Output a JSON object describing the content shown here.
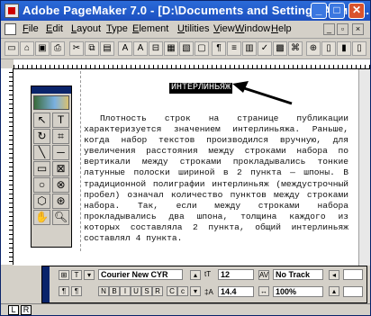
{
  "window": {
    "title": "Adobe PageMaker 7.0 - [D:\\Documents and Settings\\Админ..."
  },
  "menu": [
    "File",
    "Edit",
    "Layout",
    "Type",
    "Element",
    "Utilities",
    "View",
    "Window",
    "Help"
  ],
  "page": {
    "heading": "ИНТЕРЛИНЬЯЖ",
    "paragraph": "Плотность строк на странице публикации характеризуется значением интерлиньяжа. Раньше, когда набор текстов производился вручную, для увеличения расстояния между строками набора по вертикали между строками прокладывались тонкие латунные полоски шириной в 2 пункта — шпоны. В традиционной полиграфии интерлиньяж (междустрочный пробел) означал количество пунктов между строками набора. Так, если между строками набора прокладывались два шпона, толщина каждого из которых составляла 2 пункта, общий интерлиньяж составлял 4 пункта."
  },
  "control_palette": {
    "font": "Courier New CYR",
    "size": "12",
    "leading": "14.4",
    "tracking": "No Track",
    "width": "100%"
  },
  "page_tabs": [
    "L",
    "R"
  ],
  "colors": {
    "title_blue": "#1d50c0",
    "close_red": "#d9532c",
    "chrome": "#d4d0c8"
  }
}
